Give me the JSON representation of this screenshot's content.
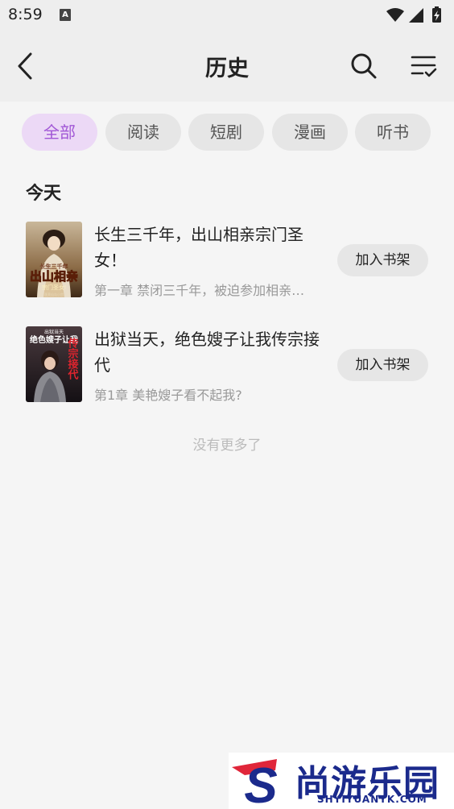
{
  "status_bar": {
    "time": "8:59",
    "notification_letter": "A"
  },
  "header": {
    "title": "历史"
  },
  "tabs": [
    {
      "label": "全部",
      "active": true
    },
    {
      "label": "阅读",
      "active": false
    },
    {
      "label": "短剧",
      "active": false
    },
    {
      "label": "漫画",
      "active": false
    },
    {
      "label": "听书",
      "active": false
    }
  ],
  "section": {
    "title": "今天"
  },
  "books": [
    {
      "title": "长生三千年，出山相亲宗门圣女！",
      "chapter": "第一章 禁闭三千年，被迫参加相亲…",
      "button_label": "加入书架",
      "cover_text": {
        "top": "长生三千年",
        "main": "出山相亲",
        "bottom": "宗门圣女!",
        "author": "蓬莱仙岛小宗"
      }
    },
    {
      "title": "出狱当天，绝色嫂子让我传宗接代",
      "chapter": "第1章 美艳嫂子看不起我?",
      "button_label": "加入书架",
      "cover_text": {
        "top": "出狱当天",
        "main": "绝色嫂子让我",
        "red": "传宗接代"
      }
    }
  ],
  "footer": {
    "end_text": "没有更多了"
  },
  "watermark": {
    "cn": "尚游乐园",
    "en": "SHYIYUANYK.COM",
    "letter": "S"
  },
  "colors": {
    "accent": "#a157d6",
    "accent_bg": "#ecd9f6",
    "watermark": "#1b2a8c",
    "watermark_red": "#e0263a"
  }
}
